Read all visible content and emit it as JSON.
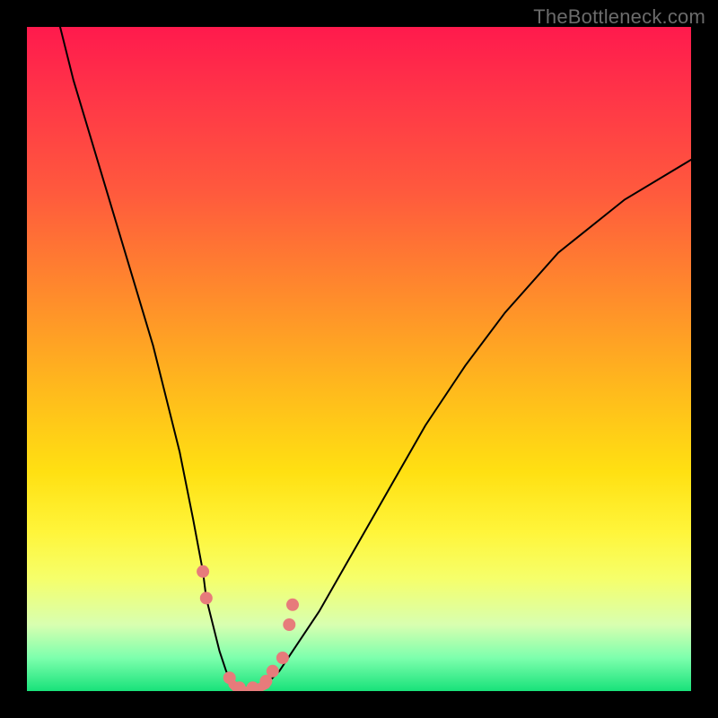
{
  "watermark": "TheBottleneck.com",
  "colors": {
    "frame": "#000000",
    "gradient_top": "#ff1a4d",
    "gradient_mid": "#ffe012",
    "gradient_bottom": "#18e27a",
    "curve": "#000000",
    "markers": "#e77b7b"
  },
  "chart_data": {
    "type": "line",
    "title": "",
    "xlabel": "",
    "ylabel": "",
    "xlim": [
      0,
      100
    ],
    "ylim": [
      0,
      100
    ],
    "grid": false,
    "legend_position": "none",
    "series": [
      {
        "name": "bottleneck-curve",
        "x": [
          5,
          7,
          10,
          13,
          16,
          19,
          21,
          23,
          25,
          26.5,
          27,
          28,
          29,
          30,
          31,
          32,
          34,
          36,
          38,
          40,
          44,
          48,
          52,
          56,
          60,
          66,
          72,
          80,
          90,
          100
        ],
        "values": [
          100,
          92,
          82,
          72,
          62,
          52,
          44,
          36,
          26,
          18,
          14,
          10,
          6,
          3,
          1,
          0,
          0,
          1,
          3,
          6,
          12,
          19,
          26,
          33,
          40,
          49,
          57,
          66,
          74,
          80
        ]
      }
    ],
    "markers": [
      {
        "x": 26.5,
        "y": 18
      },
      {
        "x": 27.0,
        "y": 14
      },
      {
        "x": 30.5,
        "y": 2
      },
      {
        "x": 32.0,
        "y": 0.5
      },
      {
        "x": 34.0,
        "y": 0.5
      },
      {
        "x": 36.0,
        "y": 1.5
      },
      {
        "x": 37.0,
        "y": 3
      },
      {
        "x": 38.5,
        "y": 5
      },
      {
        "x": 39.5,
        "y": 10
      },
      {
        "x": 40.0,
        "y": 13
      }
    ],
    "annotations": []
  }
}
